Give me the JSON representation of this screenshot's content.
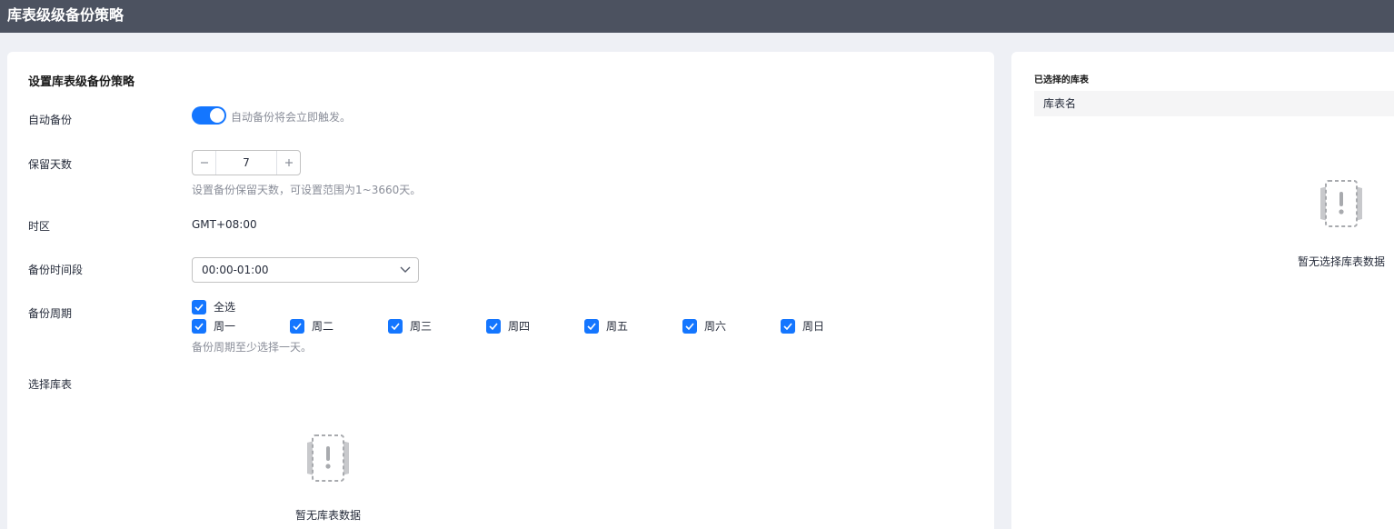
{
  "header": {
    "title": "库表级级备份策略"
  },
  "form": {
    "section_title": "设置库表级备份策略",
    "auto_backup": {
      "label": "自动备份",
      "enabled": true,
      "hint": "自动备份将会立即触发。"
    },
    "retention": {
      "label": "保留天数",
      "value": "7",
      "hint": "设置备份保留天数，可设置范围为1~3660天。"
    },
    "timezone": {
      "label": "时区",
      "value": "GMT+08:00"
    },
    "time_window": {
      "label": "备份时间段",
      "value": "00:00-01:00"
    },
    "cycle": {
      "label": "备份周期",
      "select_all": "全选",
      "days": [
        "周一",
        "周二",
        "周三",
        "周四",
        "周五",
        "周六",
        "周日"
      ],
      "hint": "备份周期至少选择一天。"
    },
    "select_tables": {
      "label": "选择库表",
      "empty_text": "暂无库表数据"
    }
  },
  "selected": {
    "title": "已选择的库表",
    "column_header": "库表名",
    "empty_text": "暂无选择库表数据"
  },
  "colors": {
    "accent": "#1476ff",
    "titlebar": "#4c5260",
    "background": "#eef0f5"
  },
  "icons": [
    "minus-icon",
    "plus-icon",
    "chevron-down-icon",
    "check-icon",
    "empty-data-icon"
  ]
}
